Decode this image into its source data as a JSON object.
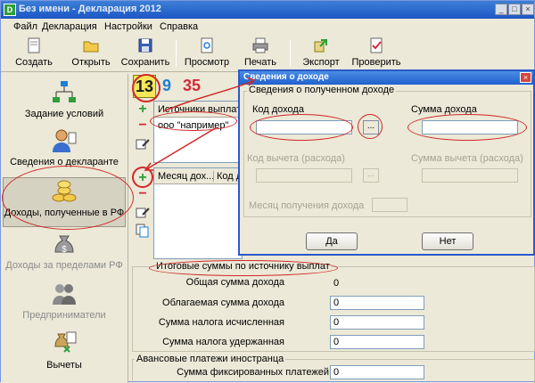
{
  "window": {
    "title": "Без имени - Декларация 2012",
    "minimize": "_",
    "maximize": "□",
    "close": "×"
  },
  "menu": [
    "Файл",
    "Декларация",
    "Настройки",
    "Справка"
  ],
  "toolbar": [
    {
      "label": "Создать",
      "icon": "new-file-icon"
    },
    {
      "label": "Открыть",
      "icon": "open-folder-icon"
    },
    {
      "label": "Сохранить",
      "icon": "save-disk-icon"
    },
    {
      "label": "Просмотр",
      "icon": "preview-icon"
    },
    {
      "label": "Печать",
      "icon": "printer-icon"
    },
    {
      "label": "Экспорт",
      "icon": "export-icon"
    },
    {
      "label": "Проверить",
      "icon": "check-icon"
    }
  ],
  "nav": [
    {
      "label": "Задание условий",
      "icon": "hierarchy-icon",
      "enabled": true
    },
    {
      "label": "Сведения о декларанте",
      "icon": "person-icon",
      "enabled": true
    },
    {
      "label": "Доходы, полученные в РФ",
      "icon": "coins-icon",
      "enabled": true,
      "selected": true
    },
    {
      "label": "Доходы за пределами РФ",
      "icon": "money-bag-icon",
      "enabled": false
    },
    {
      "label": "Предприниматели",
      "icon": "entrepreneurs-icon",
      "enabled": false
    },
    {
      "label": "Вычеты",
      "icon": "deductions-icon",
      "enabled": true
    }
  ],
  "tax_rates": [
    "13",
    "9",
    "35"
  ],
  "sources": {
    "header": "Источники выплат",
    "rows": [
      "ооо \"например\""
    ]
  },
  "months": {
    "header_1": "Месяц дох...",
    "header_2": "Код д"
  },
  "dialog": {
    "title": "Сведения о доходе",
    "group_label": "Сведения о полученном доходе",
    "income_code_label": "Код дохода",
    "income_code_value": "",
    "browse_label": "...",
    "income_amount_label": "Сумма дохода",
    "income_amount_value": "",
    "deduction_code_label": "Код вычета (расхода)",
    "deduction_amount_label": "Сумма вычета (расхода)",
    "month_label": "Месяц получения дохода",
    "yes": "Да",
    "no": "Нет",
    "close": "×"
  },
  "totals": {
    "group_label": "Итоговые суммы по источнику выплат",
    "rows": [
      {
        "label": "Общая сумма дохода",
        "value": "0",
        "readonly": true
      },
      {
        "label": "Облагаемая сумма дохода",
        "value": "0",
        "readonly": false
      },
      {
        "label": "Сумма налога исчисленная",
        "value": "0",
        "readonly": false
      },
      {
        "label": "Сумма налога удержанная",
        "value": "0",
        "readonly": false
      }
    ]
  },
  "advance": {
    "group_label": "Авансовые платежи иностранца",
    "label": "Сумма фиксированных платежей",
    "value": "0"
  },
  "colors": {
    "annotation": "#d02828",
    "titlebar": "#1c56c5"
  }
}
